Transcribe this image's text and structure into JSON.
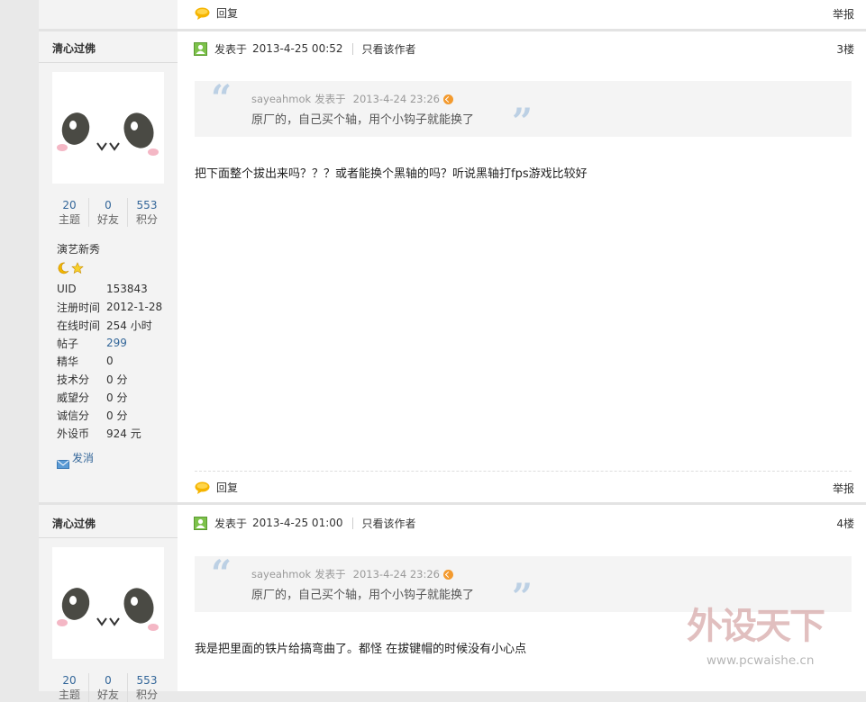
{
  "top_footer": {
    "reply": "回复",
    "report": "举报"
  },
  "posts": [
    {
      "author": {
        "name": "清心过佛",
        "stats": [
          {
            "num": "20",
            "label": "主题"
          },
          {
            "num": "0",
            "label": "好友"
          },
          {
            "num": "553",
            "label": "积分"
          }
        ],
        "rank": "演艺新秀",
        "rank_icons": [
          "moon-icon",
          "star-icon"
        ],
        "info": [
          {
            "k": "UID",
            "v": "153843"
          },
          {
            "k": "注册时间",
            "v": "2012-1-28"
          },
          {
            "k": "在线时间",
            "v": "254 小时"
          },
          {
            "k": "帖子",
            "v": "299"
          },
          {
            "k": "精华",
            "v": "0"
          },
          {
            "k": "技术分",
            "v": "0 分"
          },
          {
            "k": "威望分",
            "v": "0 分"
          },
          {
            "k": "诚信分",
            "v": "0 分"
          },
          {
            "k": "外设币",
            "v": "924 元"
          }
        ],
        "message_link": "发消"
      },
      "head": {
        "posted_label": "发表于",
        "time": "2013-4-25 00:52",
        "only_author": "只看该作者",
        "floor": "3楼"
      },
      "quote": {
        "user": "sayeahmok",
        "posted_label": "发表于",
        "time": "2013-4-24 23:26",
        "text": "原厂的，自己买个轴，用个小钩子就能换了"
      },
      "body": "把下面整个拔出来吗？？？或者能换个黑轴的吗？听说黑轴打fps游戏比较好",
      "footer": {
        "reply": "回复",
        "report": "举报"
      }
    },
    {
      "author": {
        "name": "清心过佛",
        "stats": [
          {
            "num": "20",
            "label": "主题"
          },
          {
            "num": "0",
            "label": "好友"
          },
          {
            "num": "553",
            "label": "积分"
          }
        ]
      },
      "head": {
        "posted_label": "发表于",
        "time": "2013-4-25 01:00",
        "only_author": "只看该作者",
        "floor": "4楼"
      },
      "quote": {
        "user": "sayeahmok",
        "posted_label": "发表于",
        "time": "2013-4-24 23:26",
        "text": "原厂的，自己买个轴，用个小钩子就能换了"
      },
      "body": "我是把里面的铁片给搞弯曲了。都怪 在拔键帽的时候没有小心点"
    }
  ],
  "watermark": {
    "title": "外设天下",
    "url": "www.pcwaishe.cn"
  },
  "colors": {
    "link": "#336699",
    "quote_bg": "#f4f4f4",
    "side_bg": "#f3f3f3",
    "quote_mark": "#bcd0e4"
  }
}
